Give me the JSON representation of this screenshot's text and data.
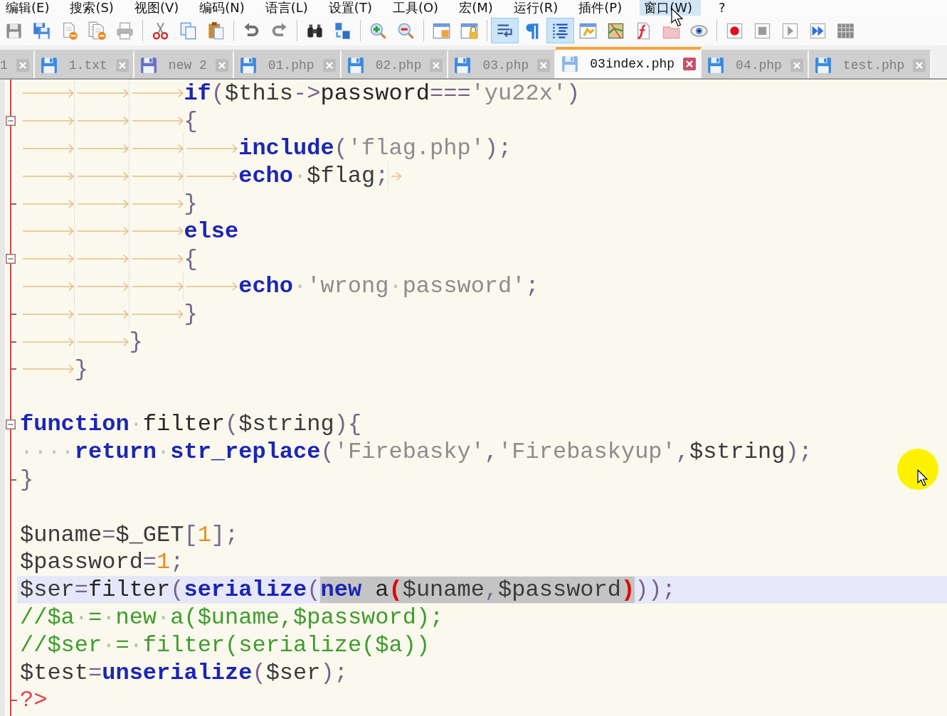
{
  "menu": [
    {
      "label": "编辑(E)",
      "highlighted": false
    },
    {
      "label": "搜索(S)",
      "highlighted": false
    },
    {
      "label": "视图(V)",
      "highlighted": false
    },
    {
      "label": "编码(N)",
      "highlighted": false
    },
    {
      "label": "语言(L)",
      "highlighted": false
    },
    {
      "label": "设置(T)",
      "highlighted": false
    },
    {
      "label": "工具(O)",
      "highlighted": false
    },
    {
      "label": "宏(M)",
      "highlighted": false
    },
    {
      "label": "运行(R)",
      "highlighted": false
    },
    {
      "label": "插件(P)",
      "highlighted": false
    },
    {
      "label": "窗口(W)",
      "highlighted": true
    },
    {
      "label": "?",
      "highlighted": false
    }
  ],
  "toolbar": [
    {
      "buttons": [
        {
          "kind": "save",
          "pressed": false
        },
        {
          "kind": "save_all",
          "pressed": false
        },
        {
          "kind": "close",
          "pressed": false
        },
        {
          "kind": "close_all",
          "pressed": false
        },
        {
          "kind": "print",
          "pressed": false
        }
      ]
    },
    {
      "buttons": [
        {
          "kind": "cut",
          "pressed": false
        },
        {
          "kind": "copy",
          "pressed": false
        },
        {
          "kind": "paste",
          "pressed": false
        }
      ]
    },
    {
      "buttons": [
        {
          "kind": "undo",
          "pressed": false
        },
        {
          "kind": "redo",
          "pressed": false
        }
      ]
    },
    {
      "buttons": [
        {
          "kind": "find",
          "pressed": false
        },
        {
          "kind": "replace",
          "pressed": false
        }
      ]
    },
    {
      "buttons": [
        {
          "kind": "zoom_in",
          "pressed": false
        },
        {
          "kind": "zoom_out",
          "pressed": false
        }
      ]
    },
    {
      "buttons": [
        {
          "kind": "sync_vertical",
          "pressed": false
        },
        {
          "kind": "sync_horizontal",
          "pressed": false
        }
      ]
    },
    {
      "buttons": [
        {
          "kind": "word_wrap",
          "pressed": true
        },
        {
          "kind": "show_all",
          "pressed": false
        },
        {
          "kind": "indent_guide",
          "pressed": true
        },
        {
          "kind": "user_language",
          "pressed": false
        },
        {
          "kind": "document_map",
          "pressed": false
        },
        {
          "kind": "function_list",
          "pressed": false
        },
        {
          "kind": "folder_workspace",
          "pressed": false
        },
        {
          "kind": "monitoring",
          "pressed": false
        }
      ]
    },
    {
      "buttons": [
        {
          "kind": "record",
          "pressed": false
        },
        {
          "kind": "stop",
          "pressed": false
        },
        {
          "kind": "play",
          "pressed": false
        },
        {
          "kind": "play_multiple",
          "pressed": false
        },
        {
          "kind": "save_macro",
          "pressed": false
        }
      ]
    }
  ],
  "tabs": [
    {
      "kind": "clipped",
      "label": "1",
      "selected": false
    },
    {
      "kind": "file",
      "label": "1.txt",
      "selected": false,
      "color": "#3d88e0"
    },
    {
      "kind": "file",
      "label": "new 2",
      "selected": false,
      "color": "#6a6ec8"
    },
    {
      "kind": "file",
      "label": "01.php",
      "selected": false,
      "color": "#3d88e0"
    },
    {
      "kind": "file",
      "label": "02.php",
      "selected": false,
      "color": "#3d88e0"
    },
    {
      "kind": "file",
      "label": "03.php",
      "selected": false,
      "color": "#3d88e0"
    },
    {
      "kind": "file",
      "label": "03index.php",
      "selected": true,
      "color": "#8ab6e6"
    },
    {
      "kind": "file",
      "label": "04.php",
      "selected": false,
      "color": "#3d88e0"
    },
    {
      "kind": "file",
      "label": "test.php",
      "selected": false,
      "color": "#3d88e0"
    }
  ],
  "editor": {
    "lines": [
      {
        "current": false,
        "segments": [
          {
            "kind": "tab"
          },
          {
            "kind": "tab"
          },
          {
            "kind": "tab"
          },
          {
            "kind": "keyword",
            "text": "if"
          },
          {
            "kind": "operator",
            "text": "("
          },
          {
            "kind": "variable",
            "text": "$this"
          },
          {
            "kind": "operator",
            "text": "->"
          },
          {
            "kind": "plain",
            "text": "password"
          },
          {
            "kind": "operator",
            "text": "==="
          },
          {
            "kind": "string",
            "text": "'yu22x'"
          },
          {
            "kind": "operator",
            "text": ")"
          }
        ]
      },
      {
        "current": false,
        "fold": {
          "kind": "open"
        },
        "segments": [
          {
            "kind": "tab"
          },
          {
            "kind": "tab"
          },
          {
            "kind": "tab"
          },
          {
            "kind": "operator",
            "text": "{"
          }
        ]
      },
      {
        "current": false,
        "segments": [
          {
            "kind": "tab"
          },
          {
            "kind": "tab"
          },
          {
            "kind": "tab"
          },
          {
            "kind": "tab"
          },
          {
            "kind": "keyword",
            "text": "include"
          },
          {
            "kind": "operator",
            "text": "("
          },
          {
            "kind": "string",
            "text": "'flag.php'"
          },
          {
            "kind": "operator",
            "text": ");"
          }
        ]
      },
      {
        "current": false,
        "segments": [
          {
            "kind": "tab"
          },
          {
            "kind": "tab"
          },
          {
            "kind": "tab"
          },
          {
            "kind": "tab"
          },
          {
            "kind": "keyword",
            "text": "echo"
          },
          {
            "kind": "space",
            "text": "·"
          },
          {
            "kind": "variable",
            "text": "$flag"
          },
          {
            "kind": "operator",
            "text": ";"
          },
          {
            "kind": "tab"
          }
        ]
      },
      {
        "current": false,
        "fold": {
          "kind": "tick"
        },
        "segments": [
          {
            "kind": "tab"
          },
          {
            "kind": "tab"
          },
          {
            "kind": "tab"
          },
          {
            "kind": "operator",
            "text": "}"
          }
        ]
      },
      {
        "current": false,
        "segments": [
          {
            "kind": "tab"
          },
          {
            "kind": "tab"
          },
          {
            "kind": "tab"
          },
          {
            "kind": "keyword",
            "text": "else"
          }
        ]
      },
      {
        "current": false,
        "fold": {
          "kind": "open"
        },
        "segments": [
          {
            "kind": "tab"
          },
          {
            "kind": "tab"
          },
          {
            "kind": "tab"
          },
          {
            "kind": "operator",
            "text": "{"
          }
        ]
      },
      {
        "current": false,
        "segments": [
          {
            "kind": "tab"
          },
          {
            "kind": "tab"
          },
          {
            "kind": "tab"
          },
          {
            "kind": "tab"
          },
          {
            "kind": "keyword",
            "text": "echo"
          },
          {
            "kind": "space",
            "text": "·"
          },
          {
            "kind": "string",
            "text": "'wrong"
          },
          {
            "kind": "space",
            "text": "·"
          },
          {
            "kind": "string",
            "text": "password'"
          },
          {
            "kind": "operator",
            "text": ";"
          }
        ]
      },
      {
        "current": false,
        "fold": {
          "kind": "tick"
        },
        "segments": [
          {
            "kind": "tab"
          },
          {
            "kind": "tab"
          },
          {
            "kind": "tab"
          },
          {
            "kind": "operator",
            "text": "}"
          }
        ]
      },
      {
        "current": false,
        "fold": {
          "kind": "tick"
        },
        "segments": [
          {
            "kind": "tab"
          },
          {
            "kind": "tab"
          },
          {
            "kind": "operator",
            "text": "}"
          }
        ]
      },
      {
        "current": false,
        "fold": {
          "kind": "tick"
        },
        "segments": [
          {
            "kind": "tab"
          },
          {
            "kind": "operator",
            "text": "}"
          }
        ]
      },
      {
        "current": false
      },
      {
        "current": false,
        "fold": {
          "kind": "open"
        },
        "segments": [
          {
            "kind": "keyword",
            "text": "function"
          },
          {
            "kind": "space",
            "text": "·"
          },
          {
            "kind": "plain",
            "text": "filter"
          },
          {
            "kind": "operator",
            "text": "("
          },
          {
            "kind": "variable",
            "text": "$string"
          },
          {
            "kind": "operator",
            "text": "){"
          }
        ]
      },
      {
        "current": false,
        "segments": [
          {
            "kind": "space",
            "text": "····"
          },
          {
            "kind": "keyword",
            "text": "return"
          },
          {
            "kind": "space",
            "text": "·"
          },
          {
            "kind": "keyword",
            "text": "str_replace"
          },
          {
            "kind": "operator",
            "text": "("
          },
          {
            "kind": "string",
            "text": "'Firebasky'"
          },
          {
            "kind": "operator",
            "text": ","
          },
          {
            "kind": "string",
            "text": "'Firebaskyup'"
          },
          {
            "kind": "operator",
            "text": ","
          },
          {
            "kind": "variable",
            "text": "$string"
          },
          {
            "kind": "operator",
            "text": ");"
          }
        ]
      },
      {
        "current": false,
        "fold": {
          "kind": "tick"
        },
        "segments": [
          {
            "kind": "operator",
            "text": "}"
          }
        ]
      },
      {
        "current": false
      },
      {
        "current": false,
        "segments": [
          {
            "kind": "variable",
            "text": "$uname"
          },
          {
            "kind": "operator",
            "text": "="
          },
          {
            "kind": "variable",
            "text": "$_GET"
          },
          {
            "kind": "operator",
            "text": "["
          },
          {
            "kind": "number",
            "text": "1"
          },
          {
            "kind": "operator",
            "text": "];"
          }
        ]
      },
      {
        "current": false,
        "segments": [
          {
            "kind": "variable",
            "text": "$password"
          },
          {
            "kind": "operator",
            "text": "="
          },
          {
            "kind": "number",
            "text": "1"
          },
          {
            "kind": "operator",
            "text": ";"
          }
        ]
      },
      {
        "current": true,
        "segments": [
          {
            "kind": "variable",
            "text": "$ser"
          },
          {
            "kind": "operator",
            "text": "="
          },
          {
            "kind": "plain",
            "text": "filter"
          },
          {
            "kind": "operator",
            "text": "("
          },
          {
            "kind": "keyword",
            "text": "serialize"
          },
          {
            "kind": "operator",
            "text": "("
          },
          {
            "kind": "selection",
            "segments": [
              {
                "kind": "keyword",
                "text": "new"
              },
              {
                "kind": "plain",
                "text": " a"
              },
              {
                "kind": "brace_match",
                "text": "("
              },
              {
                "kind": "variable",
                "text": "$uname"
              },
              {
                "kind": "operator",
                "text": ","
              },
              {
                "kind": "variable",
                "text": "$password"
              },
              {
                "kind": "brace_match",
                "text": ")"
              }
            ]
          },
          {
            "kind": "operator",
            "text": "));"
          }
        ]
      },
      {
        "current": false,
        "segments": [
          {
            "kind": "comment",
            "text": "//$a"
          },
          {
            "kind": "comment_space",
            "text": "·"
          },
          {
            "kind": "comment",
            "text": "="
          },
          {
            "kind": "comment_space",
            "text": "·"
          },
          {
            "kind": "comment",
            "text": "new"
          },
          {
            "kind": "comment_space",
            "text": "·"
          },
          {
            "kind": "comment",
            "text": "a($uname,$password);"
          }
        ]
      },
      {
        "current": false,
        "segments": [
          {
            "kind": "comment",
            "text": "//$ser"
          },
          {
            "kind": "comment_space",
            "text": "·"
          },
          {
            "kind": "comment",
            "text": "="
          },
          {
            "kind": "comment_space",
            "text": "·"
          },
          {
            "kind": "comment",
            "text": "filter(serialize($a))"
          }
        ]
      },
      {
        "current": false,
        "segments": [
          {
            "kind": "variable",
            "text": "$test"
          },
          {
            "kind": "operator",
            "text": "="
          },
          {
            "kind": "keyword",
            "text": "unserialize"
          },
          {
            "kind": "operator",
            "text": "("
          },
          {
            "kind": "variable",
            "text": "$ser"
          },
          {
            "kind": "operator",
            "text": ");"
          }
        ]
      },
      {
        "current": false,
        "fold": {
          "kind": "end"
        },
        "segments": [
          {
            "kind": "tag",
            "text": "?>"
          }
        ]
      }
    ]
  }
}
